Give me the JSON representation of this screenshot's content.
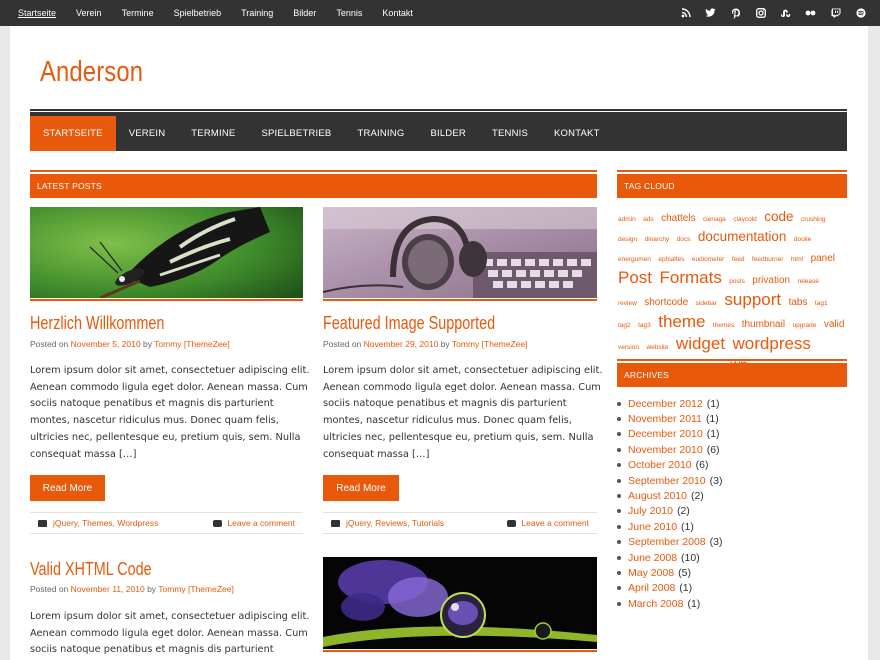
{
  "topnav": [
    "Startseite",
    "Verein",
    "Termine",
    "Spielbetrieb",
    "Training",
    "Bilder",
    "Tennis",
    "Kontakt"
  ],
  "social_icons": [
    "rss-icon",
    "twitter-icon",
    "pinterest-icon",
    "instagram-icon",
    "stumbleupon-icon",
    "flickr-icon",
    "twitch-icon",
    "spotify-icon"
  ],
  "site_title": "Anderson",
  "mainnav": [
    "STARTSEITE",
    "VEREIN",
    "TERMINE",
    "SPIELBETRIEB",
    "TRAINING",
    "BILDER",
    "TENNIS",
    "KONTAKT"
  ],
  "latest_posts_title": "LATEST POSTS",
  "posts": [
    {
      "title": "Herzlich Willkommen",
      "posted_on": "Posted on",
      "date": "November 5, 2010",
      "by": "by",
      "author": "Tommy [ThemeZee]",
      "excerpt": "Lorem ipsum dolor sit amet, consectetuer adipiscing elit. Aenean commodo ligula eget dolor. Aenean massa. Cum sociis natoque penatibus et magnis dis parturient montes, nascetur ridiculus mus. Donec quam felis, ultricies nec, pellentesque eu, pretium quis, sem. Nulla consequat massa […]",
      "read_more": "Read More",
      "categories": "jQuery, Themes, Wordpress",
      "comment": "Leave a comment"
    },
    {
      "title": "Featured Image Supported",
      "posted_on": "Posted on",
      "date": "November 29, 2010",
      "by": "by",
      "author": "Tommy [ThemeZee]",
      "excerpt": "Lorem ipsum dolor sit amet, consectetuer adipiscing elit. Aenean commodo ligula eget dolor. Aenean massa. Cum sociis natoque penatibus et magnis dis parturient montes, nascetur ridiculus mus. Donec quam felis, ultricies nec, pellentesque eu, pretium quis, sem. Nulla consequat massa […]",
      "read_more": "Read More",
      "categories": "jQuery, Reviews, Tutorials",
      "comment": "Leave a comment"
    },
    {
      "title": "Valid XHTML Code",
      "posted_on": "Posted on",
      "date": "November 11, 2010",
      "by": "by",
      "author": "Tommy [ThemeZee]",
      "excerpt": "Lorem ipsum dolor sit amet, consectetuer adipiscing elit. Aenean commodo ligula eget dolor. Aenean massa. Cum sociis natoque penatibus et magnis dis parturient"
    }
  ],
  "tag_cloud_title": "TAG CLOUD",
  "tags": [
    {
      "t": "admin",
      "s": 1
    },
    {
      "t": "ads",
      "s": 1
    },
    {
      "t": "chattels",
      "s": 2
    },
    {
      "t": "cienaga",
      "s": 1
    },
    {
      "t": "claycold",
      "s": 1
    },
    {
      "t": "code",
      "s": 3
    },
    {
      "t": "crushing",
      "s": 1
    },
    {
      "t": "design",
      "s": 1
    },
    {
      "t": "dinarchy",
      "s": 1
    },
    {
      "t": "docs",
      "s": 1
    },
    {
      "t": "documentation",
      "s": 3
    },
    {
      "t": "doolie",
      "s": 1
    },
    {
      "t": "energumen",
      "s": 1
    },
    {
      "t": "ephialtes",
      "s": 1
    },
    {
      "t": "eudiometer",
      "s": 1
    },
    {
      "t": "feed",
      "s": 1
    },
    {
      "t": "feedburner",
      "s": 1
    },
    {
      "t": "html",
      "s": 1
    },
    {
      "t": "panel",
      "s": 2
    },
    {
      "t": "Post",
      "s": 4
    },
    {
      "t": "Formats",
      "s": 4
    },
    {
      "t": "posts",
      "s": 1
    },
    {
      "t": "privation",
      "s": 2
    },
    {
      "t": "release",
      "s": 1
    },
    {
      "t": "review",
      "s": 1
    },
    {
      "t": "shortcode",
      "s": 2
    },
    {
      "t": "sidebar",
      "s": 1
    },
    {
      "t": "support",
      "s": 4
    },
    {
      "t": "tabs",
      "s": 2
    },
    {
      "t": "tag1",
      "s": 1
    },
    {
      "t": "tag2",
      "s": 1
    },
    {
      "t": "tag3",
      "s": 1
    },
    {
      "t": "theme",
      "s": 4
    },
    {
      "t": "themes",
      "s": 1
    },
    {
      "t": "thumbnail",
      "s": 2
    },
    {
      "t": "upgrade",
      "s": 1
    },
    {
      "t": "valid",
      "s": 2
    },
    {
      "t": "version",
      "s": 1
    },
    {
      "t": "website",
      "s": 1
    },
    {
      "t": "widget",
      "s": 4
    },
    {
      "t": "wordpress",
      "s": 4
    },
    {
      "t": "wordpress",
      "s": 1
    },
    {
      "t": "wordpress",
      "s": 1
    },
    {
      "t": "wordpress",
      "s": 1
    },
    {
      "t": "wp",
      "s": 3
    }
  ],
  "archives_title": "ARCHIVES",
  "archives": [
    {
      "m": "December 2012",
      "c": "(1)"
    },
    {
      "m": "November 2011",
      "c": "(1)"
    },
    {
      "m": "December 2010",
      "c": "(1)"
    },
    {
      "m": "November 2010",
      "c": "(6)"
    },
    {
      "m": "October 2010",
      "c": "(6)"
    },
    {
      "m": "September 2010",
      "c": "(3)"
    },
    {
      "m": "August 2010",
      "c": "(2)"
    },
    {
      "m": "July 2010",
      "c": "(2)"
    },
    {
      "m": "June 2010",
      "c": "(1)"
    },
    {
      "m": "September 2008",
      "c": "(3)"
    },
    {
      "m": "June 2008",
      "c": "(10)"
    },
    {
      "m": "May 2008",
      "c": "(5)"
    },
    {
      "m": "April 2008",
      "c": "(1)"
    },
    {
      "m": "March 2008",
      "c": "(1)"
    }
  ],
  "colors": {
    "accent": "#e8590c",
    "dark": "#333333"
  }
}
